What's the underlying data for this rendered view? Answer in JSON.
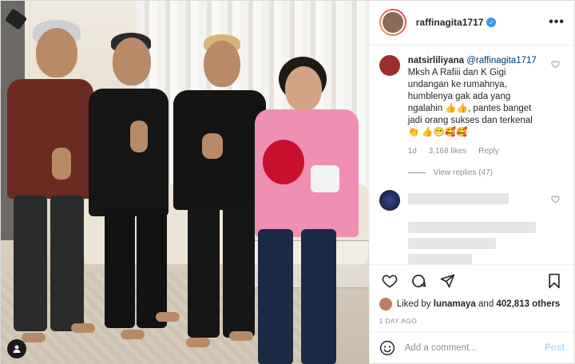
{
  "header": {
    "username": "raffinagita1717",
    "verified_glyph": "✓",
    "more_label": "•••"
  },
  "comments": [
    {
      "username": "natsirliliyana",
      "mention": "@raffinagita1717",
      "text": "Mksh A Rafiii dan K Gigi undangan ke rumahnya, humblenya gak ada yang ngalahin 👍👍, pantes banget jadi orang sukses dan terkenal 👏 👍😁🥰🥰",
      "age": "1d",
      "likes": "3,168 likes",
      "reply_label": "Reply",
      "view_replies": "View replies (47)"
    }
  ],
  "actions": {
    "like_icon": "heart-icon",
    "comment_icon": "comment-icon",
    "share_icon": "send-icon",
    "save_icon": "bookmark-icon"
  },
  "likes": {
    "prefix": "Liked by",
    "user": "lunamaya",
    "and": "and",
    "others": "402,813 others"
  },
  "timestamp": "1 DAY AGO",
  "add_comment": {
    "placeholder": "Add a comment...",
    "post_label": "Post"
  },
  "colors": {
    "verified": "#3897f0",
    "post_button": "#b3dbff",
    "link": "#00376b"
  }
}
